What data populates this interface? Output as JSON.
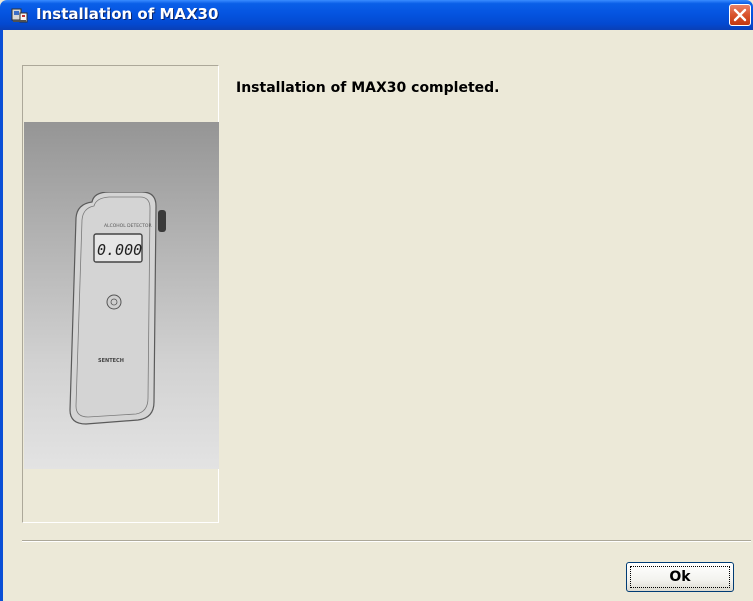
{
  "window": {
    "title": "Installation of MAX30",
    "icon": "installer-icon",
    "close_icon": "close-icon"
  },
  "main": {
    "message": "Installation of MAX30 completed."
  },
  "device_image": {
    "display_value": "0.000"
  },
  "footer": {
    "ok_label": "Ok"
  },
  "colors": {
    "titlebar": "#0554e0",
    "face": "#ece9d8",
    "close": "#d9532c"
  }
}
